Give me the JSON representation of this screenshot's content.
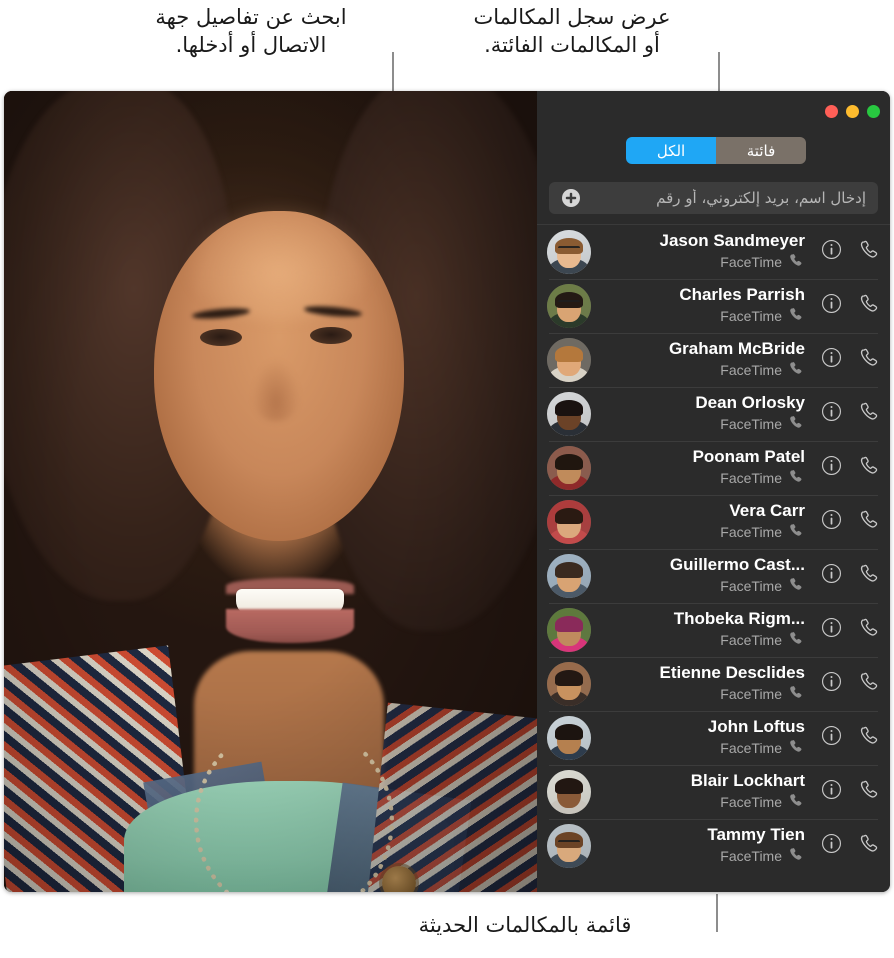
{
  "annotations": {
    "search": "ابحث عن تفاصيل جهة\nالاتصال أو أدخلها.",
    "filter": "عرض سجل المكالمات\nأو المكالمات الفائتة.",
    "recents": "قائمة بالمكالمات الحديثة"
  },
  "window": {
    "traffic_lights": [
      {
        "name": "close",
        "color": "#ff5f57"
      },
      {
        "name": "minimize",
        "color": "#febc2e"
      },
      {
        "name": "zoom",
        "color": "#28c840"
      }
    ]
  },
  "sidebar": {
    "segmented_control": {
      "options": [
        {
          "label": "الكل",
          "active": true
        },
        {
          "label": "فائتة",
          "active": false
        }
      ],
      "active_color": "#1fa7f5",
      "inactive_color": "#7a7168"
    },
    "search": {
      "placeholder": "إدخال اسم، بريد إلكتروني، أو رقم",
      "value": "",
      "add_icon": "plus-circle-icon"
    },
    "calls": [
      {
        "name": "Jason Sandmeyer",
        "service": "FaceTime",
        "skin": "#e8b98f",
        "hair": "#8a5b32",
        "bg": "#d9dde0",
        "glasses": true,
        "shirt": "#3c4650"
      },
      {
        "name": "Charles Parrish",
        "service": "FaceTime",
        "skin": "#d9a473",
        "hair": "#241a14",
        "bg": "#6d7d45",
        "glasses": true,
        "shirt": "#2b3a2a"
      },
      {
        "name": "Graham McBride",
        "service": "FaceTime",
        "skin": "#e0a878",
        "hair": "#b4783c",
        "bg": "#6f6a62",
        "glasses": false,
        "shirt": "#d8d2c6"
      },
      {
        "name": "Dean Orlosky",
        "service": "FaceTime",
        "skin": "#6b4227",
        "hair": "#1a1210",
        "bg": "#d6d8da",
        "glasses": false,
        "shirt": "#2a2f36"
      },
      {
        "name": "Poonam Patel",
        "service": "FaceTime",
        "skin": "#c08b5b",
        "hair": "#20160f",
        "bg": "#8e5a4a",
        "glasses": false,
        "shirt": "#8f2a2a"
      },
      {
        "name": "Vera Carr",
        "service": "FaceTime",
        "skin": "#dba87d",
        "hair": "#2a1a12",
        "bg": "#b03a3a",
        "glasses": false,
        "shirt": "#c24b4b"
      },
      {
        "name": "Guillermo Cast...",
        "service": "FaceTime",
        "skin": "#d8a373",
        "hair": "#3a2a20",
        "bg": "#9fb3c4",
        "glasses": false,
        "shirt": "#4c5a68"
      },
      {
        "name": "Thobeka Rigm...",
        "service": "FaceTime",
        "skin": "#c08a5e",
        "hair": "#8a2a5a",
        "bg": "#5d7a3a",
        "glasses": false,
        "shirt": "#d8357a"
      },
      {
        "name": "Etienne Desclides",
        "service": "FaceTime",
        "skin": "#c8925f",
        "hair": "#231813",
        "bg": "#9a6b4a",
        "glasses": false,
        "shirt": "#3a2e28"
      },
      {
        "name": "John Loftus",
        "service": "FaceTime",
        "skin": "#b5804f",
        "hair": "#1c1410",
        "bg": "#c9d3d9",
        "glasses": false,
        "shirt": "#2e3c4c"
      },
      {
        "name": "Blair Lockhart",
        "service": "FaceTime",
        "skin": "#8a5a38",
        "hair": "#221712",
        "bg": "#dcdcd4",
        "glasses": false,
        "shirt": "#c8c4bc"
      },
      {
        "name": "Tammy Tien",
        "service": "FaceTime",
        "skin": "#d9a97c",
        "hair": "#6b4326",
        "bg": "#b9c2c8",
        "glasses": true,
        "shirt": "#3e4a56"
      }
    ],
    "row_icons": {
      "audio_call": "phone-handset-icon",
      "info": "info-circle-icon",
      "service": "phone-handset-small-icon"
    }
  }
}
